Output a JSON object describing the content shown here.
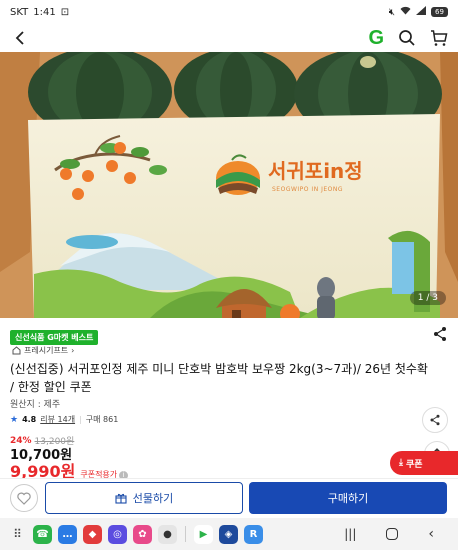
{
  "status": {
    "carrier": "SKT",
    "time": "1:41",
    "battery": "69"
  },
  "colors": {
    "brand_green": "#1fb12c",
    "sale_red": "#e8282b",
    "buy_blue": "#1849b4"
  },
  "hero": {
    "box_logo": "서귀포in정",
    "box_logo_sub": "SEOGWIPO IN JEONG",
    "image_counter": "1 / 3"
  },
  "product": {
    "badge": "신선식품 G마켓 베스트",
    "brand": "프레시기프트",
    "title": "(신선집중) 서귀포인정 제주 미니 단호박 밤호박 보우짱 2kg(3~7과)/ 26년 첫수확 / 한정 할인 쿠폰",
    "origin": "원산지 : 제주",
    "rating": "4.8",
    "reviews": "리뷰 14개",
    "purchases": "구매 861",
    "discount_pct": "24%",
    "original_price": "13,200원",
    "sale_price": "10,700원",
    "coupon_price": "9,990원",
    "coupon_note": "쿠폰적용가",
    "coupon_button": "쿠폰"
  },
  "buybar": {
    "gift_label": "선물하기",
    "buy_label": "구매하기"
  }
}
